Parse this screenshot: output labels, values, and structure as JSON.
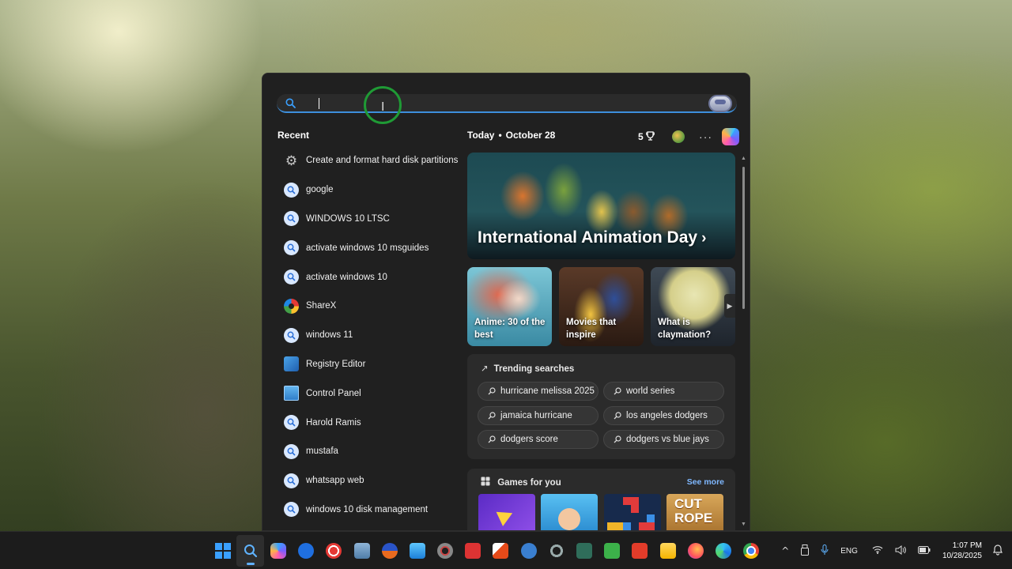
{
  "search": {
    "value": "",
    "placeholder": ""
  },
  "recent": {
    "title": "Recent",
    "items": [
      {
        "label": "Create and format hard disk partitions",
        "icon": "settings-gear-icon"
      },
      {
        "label": "google",
        "icon": "search-icon"
      },
      {
        "label": "WINDOWS 10 LTSC",
        "icon": "search-icon"
      },
      {
        "label": "activate windows 10 msguides",
        "icon": "search-icon"
      },
      {
        "label": "activate windows 10",
        "icon": "search-icon"
      },
      {
        "label": "ShareX",
        "icon": "sharex-icon"
      },
      {
        "label": "windows 11",
        "icon": "search-icon"
      },
      {
        "label": "Registry Editor",
        "icon": "registry-editor-icon"
      },
      {
        "label": "Control Panel",
        "icon": "control-panel-icon"
      },
      {
        "label": "Harold Ramis",
        "icon": "search-icon"
      },
      {
        "label": "mustafa",
        "icon": "search-icon"
      },
      {
        "label": "whatsapp web",
        "icon": "search-icon"
      },
      {
        "label": "windows 10 disk management",
        "icon": "search-icon"
      }
    ]
  },
  "today": {
    "label": "Today",
    "separator": "•",
    "date": "October 28"
  },
  "rewards": {
    "points": "5"
  },
  "more_label": "···",
  "hero": {
    "title": "International Animation Day",
    "chevron": "›"
  },
  "cards": [
    {
      "caption": "Anime: 30 of the best"
    },
    {
      "caption": "Movies that inspire"
    },
    {
      "caption": "What is claymation?"
    }
  ],
  "card_next": "▶",
  "trending": {
    "title": "Trending searches",
    "arrow": "↗",
    "items": [
      "hurricane melissa 2025",
      "world series",
      "jamaica hurricane",
      "los angeles dodgers",
      "dodgers score",
      "dodgers vs blue jays"
    ]
  },
  "games": {
    "title": "Games for you",
    "see_more": "See more",
    "thumb_text": "CUT ROPE"
  },
  "scroll": {
    "up": "▲",
    "down": "▼"
  },
  "tray": {
    "chevron": "^",
    "language": "ENG",
    "time": "1:07 PM",
    "date": "10/28/2025"
  },
  "colors": {
    "accent": "#3d8fdc",
    "focus_ring": "#1f9a35",
    "panel_bg": "#202020",
    "taskbar_bg": "#1c1c1c"
  }
}
